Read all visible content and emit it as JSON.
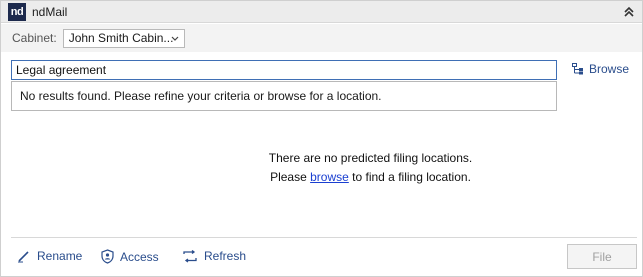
{
  "app": {
    "logo_text": "nd",
    "title": "ndMail"
  },
  "cabinet": {
    "label": "Cabinet:",
    "selected": "John Smith Cabin..."
  },
  "search": {
    "value": "Legal agreement"
  },
  "dropdown": {
    "message": "No results found. Please refine your criteria or browse for a location."
  },
  "browse": {
    "label": "Browse",
    "icon": "tree-icon"
  },
  "predictions": {
    "empty_message": "There are no predicted filing locations.",
    "please_prefix": "Please",
    "browse_link": "browse",
    "please_suffix": "to find a filing location."
  },
  "actions": {
    "rename_label": "Rename",
    "access_label": "Access",
    "refresh_label": "Refresh",
    "file_label": "File"
  },
  "colors": {
    "accent": "#2a4d8c",
    "link": "#1a3fd1",
    "logo_bg": "#1d2a4d"
  }
}
